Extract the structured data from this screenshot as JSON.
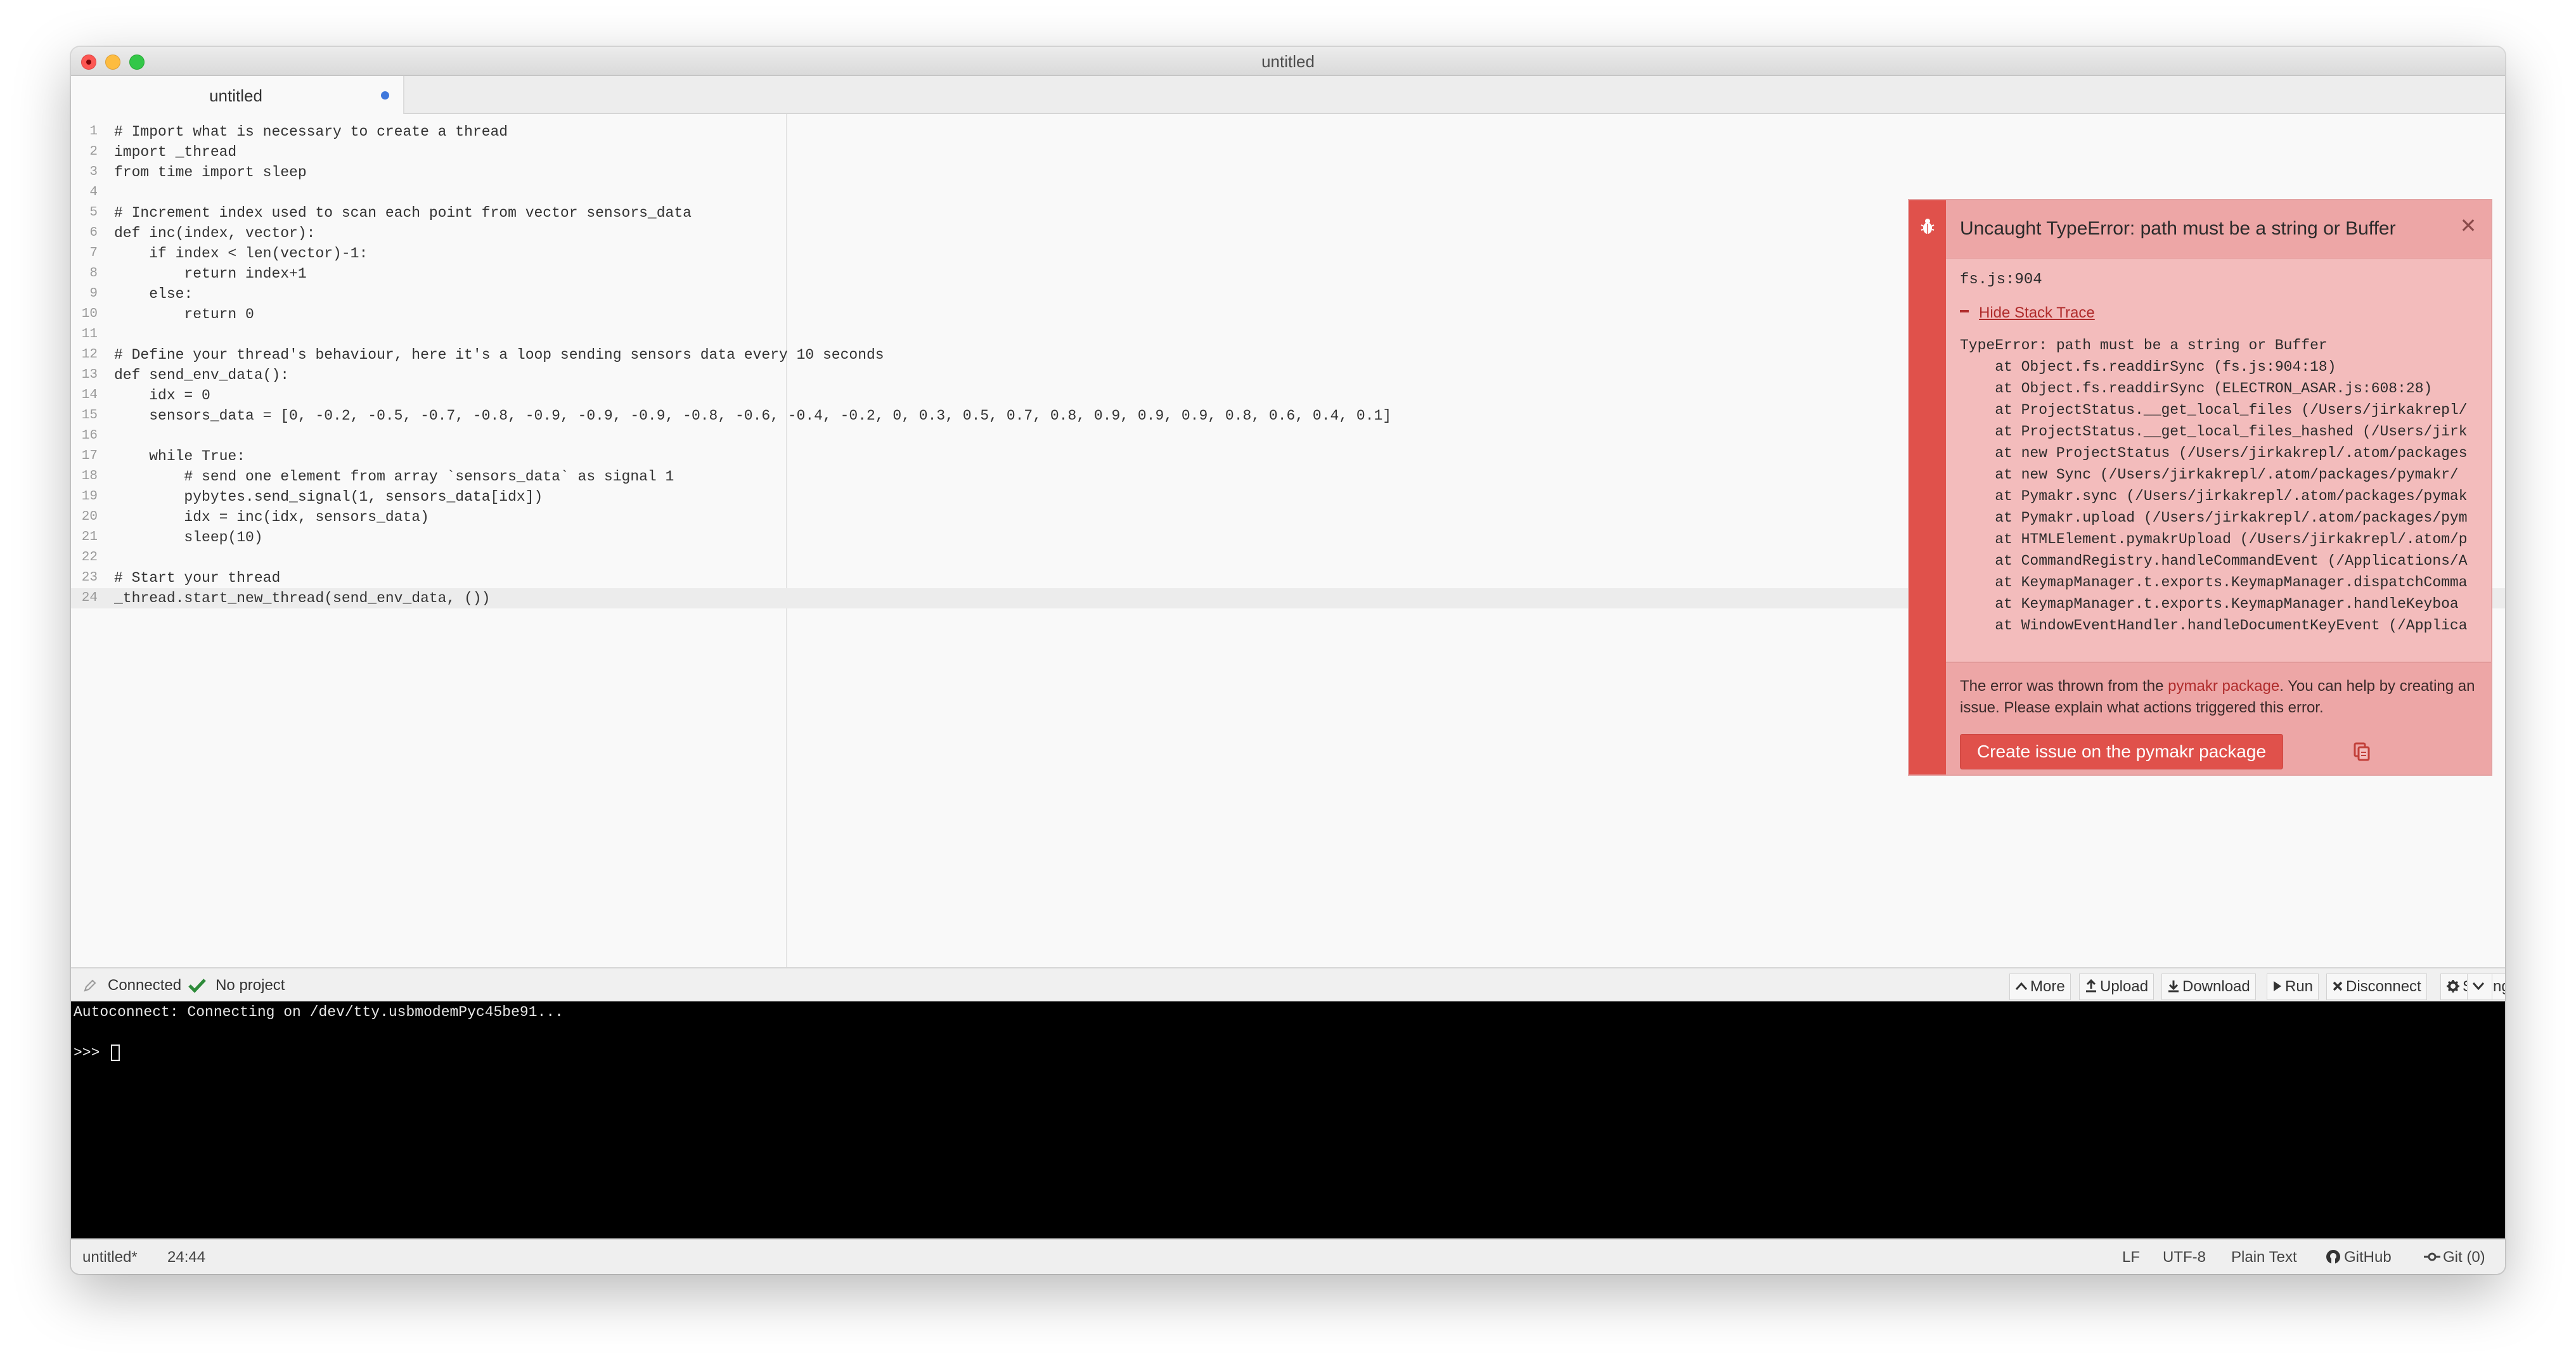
{
  "window": {
    "title": "untitled"
  },
  "tabs": [
    {
      "label": "untitled",
      "modified": true
    }
  ],
  "editor": {
    "active_line": 24,
    "lines": [
      {
        "n": "1",
        "text": "# Import what is necessary to create a thread"
      },
      {
        "n": "2",
        "text": "import _thread"
      },
      {
        "n": "3",
        "text": "from time import sleep"
      },
      {
        "n": "4",
        "text": ""
      },
      {
        "n": "5",
        "text": "# Increment index used to scan each point from vector sensors_data"
      },
      {
        "n": "6",
        "text": "def inc(index, vector):"
      },
      {
        "n": "7",
        "text": "    if index < len(vector)-1:"
      },
      {
        "n": "8",
        "text": "        return index+1"
      },
      {
        "n": "9",
        "text": "    else:"
      },
      {
        "n": "10",
        "text": "        return 0"
      },
      {
        "n": "11",
        "text": ""
      },
      {
        "n": "12",
        "text": "# Define your thread's behaviour, here it's a loop sending sensors data every 10 seconds"
      },
      {
        "n": "13",
        "text": "def send_env_data():"
      },
      {
        "n": "14",
        "text": "    idx = 0"
      },
      {
        "n": "15",
        "text": "    sensors_data = [0, -0.2, -0.5, -0.7, -0.8, -0.9, -0.9, -0.9, -0.8, -0.6, -0.4, -0.2, 0, 0.3, 0.5, 0.7, 0.8, 0.9, 0.9, 0.9, 0.8, 0.6, 0.4, 0.1]"
      },
      {
        "n": "16",
        "text": ""
      },
      {
        "n": "17",
        "text": "    while True:"
      },
      {
        "n": "18",
        "text": "        # send one element from array `sensors_data` as signal 1"
      },
      {
        "n": "19",
        "text": "        pybytes.send_signal(1, sensors_data[idx])"
      },
      {
        "n": "20",
        "text": "        idx = inc(idx, sensors_data)"
      },
      {
        "n": "21",
        "text": "        sleep(10)"
      },
      {
        "n": "22",
        "text": ""
      },
      {
        "n": "23",
        "text": "# Start your thread"
      },
      {
        "n": "24",
        "text": "_thread.start_new_thread(send_env_data, ())"
      }
    ]
  },
  "notification": {
    "title": "Uncaught TypeError: path must be a string or Buffer",
    "source": "fs.js:904",
    "stack_toggle_label": "Hide Stack Trace",
    "stack_trace": [
      "TypeError: path must be a string or Buffer",
      "    at Object.fs.readdirSync (fs.js:904:18)",
      "    at Object.fs.readdirSync (ELECTRON_ASAR.js:608:28)",
      "    at ProjectStatus.__get_local_files (/Users/jirkakrepl/",
      "    at ProjectStatus.__get_local_files_hashed (/Users/jirk",
      "    at new ProjectStatus (/Users/jirkakrepl/.atom/packages",
      "    at new Sync (/Users/jirkakrepl/.atom/packages/pymakr/",
      "    at Pymakr.sync (/Users/jirkakrepl/.atom/packages/pymak",
      "    at Pymakr.upload (/Users/jirkakrepl/.atom/packages/pym",
      "    at HTMLElement.pymakrUpload (/Users/jirkakrepl/.atom/p",
      "    at CommandRegistry.handleCommandEvent (/Applications/A",
      "    at KeymapManager.t.exports.KeymapManager.dispatchComma",
      "    at KeymapManager.t.exports.KeymapManager.handleKeyboa",
      "    at WindowEventHandler.handleDocumentKeyEvent (/Applica"
    ],
    "description_prefix": "The error was thrown from the ",
    "description_link": "pymakr package",
    "description_suffix": ". You can help by creating an issue. Please explain what actions triggered this error.",
    "create_issue_label": "Create issue on the pymakr package",
    "accent_color": "#e0514b"
  },
  "pymakr": {
    "status_label": "Connected",
    "project_label": "No project",
    "buttons": [
      {
        "label": "More",
        "icon": "chevron-up-icon"
      },
      {
        "label": "Upload",
        "icon": "upload-icon"
      },
      {
        "label": "Download",
        "icon": "download-icon"
      },
      {
        "label": "Run",
        "icon": "play-icon"
      },
      {
        "label": "Disconnect",
        "icon": "x-icon"
      },
      {
        "label": "Settings",
        "icon": "gear-icon"
      }
    ]
  },
  "terminal": {
    "lines": [
      "Autoconnect: Connecting on /dev/tty.usbmodemPyc45be91...",
      "",
      ">>> "
    ]
  },
  "statusbar": {
    "file": "untitled*",
    "cursor_position": "24:44",
    "line_ending": "LF",
    "encoding": "UTF-8",
    "grammar": "Plain Text",
    "github_label": "GitHub",
    "git_label": "Git (0)"
  }
}
